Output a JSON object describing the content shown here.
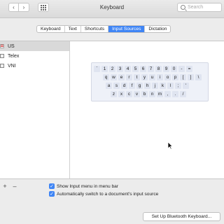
{
  "window": {
    "title": "Keyboard"
  },
  "toolbar": {
    "back_icon": "chevron-left-icon",
    "forward_icon": "chevron-right-icon",
    "grid_icon": "grid-icon"
  },
  "search": {
    "placeholder": "Search"
  },
  "tabs": [
    {
      "label": "Keyboard",
      "active": false
    },
    {
      "label": "Text",
      "active": false
    },
    {
      "label": "Shortcuts",
      "active": false
    },
    {
      "label": "Input Sources",
      "active": true
    },
    {
      "label": "Dictation",
      "active": false
    }
  ],
  "sources": [
    {
      "label": "US",
      "selected": true,
      "icon": "us-flag-icon"
    },
    {
      "label": "Telex",
      "selected": false,
      "icon": "telex-icon"
    },
    {
      "label": "VNI",
      "selected": false,
      "icon": "vni-icon"
    }
  ],
  "keyboard": {
    "rows": [
      [
        "`",
        "1",
        "2",
        "3",
        "4",
        "5",
        "6",
        "7",
        "8",
        "9",
        "0",
        "-",
        "="
      ],
      [
        "q",
        "w",
        "e",
        "r",
        "t",
        "y",
        "u",
        "i",
        "o",
        "p",
        "[",
        "]",
        "\\"
      ],
      [
        "a",
        "s",
        "d",
        "f",
        "g",
        "h",
        "j",
        "k",
        "l",
        ";",
        "'"
      ],
      [
        "z",
        "x",
        "c",
        "v",
        "b",
        "n",
        "m",
        ",",
        ".",
        "/"
      ]
    ]
  },
  "list_controls": {
    "add_label": "+",
    "remove_label": "–"
  },
  "options": {
    "show_menu": {
      "label": "Show Input menu in menu bar",
      "checked": true
    },
    "auto_switch": {
      "label": "Automatically switch to a document's input source",
      "checked": true
    }
  },
  "bluetooth_button": {
    "label": "Set Up Bluetooth Keyboard..."
  },
  "colors": {
    "accent": "#3f85f5",
    "toolbar": "#e2e2e2",
    "key": "#dfe4f0"
  }
}
